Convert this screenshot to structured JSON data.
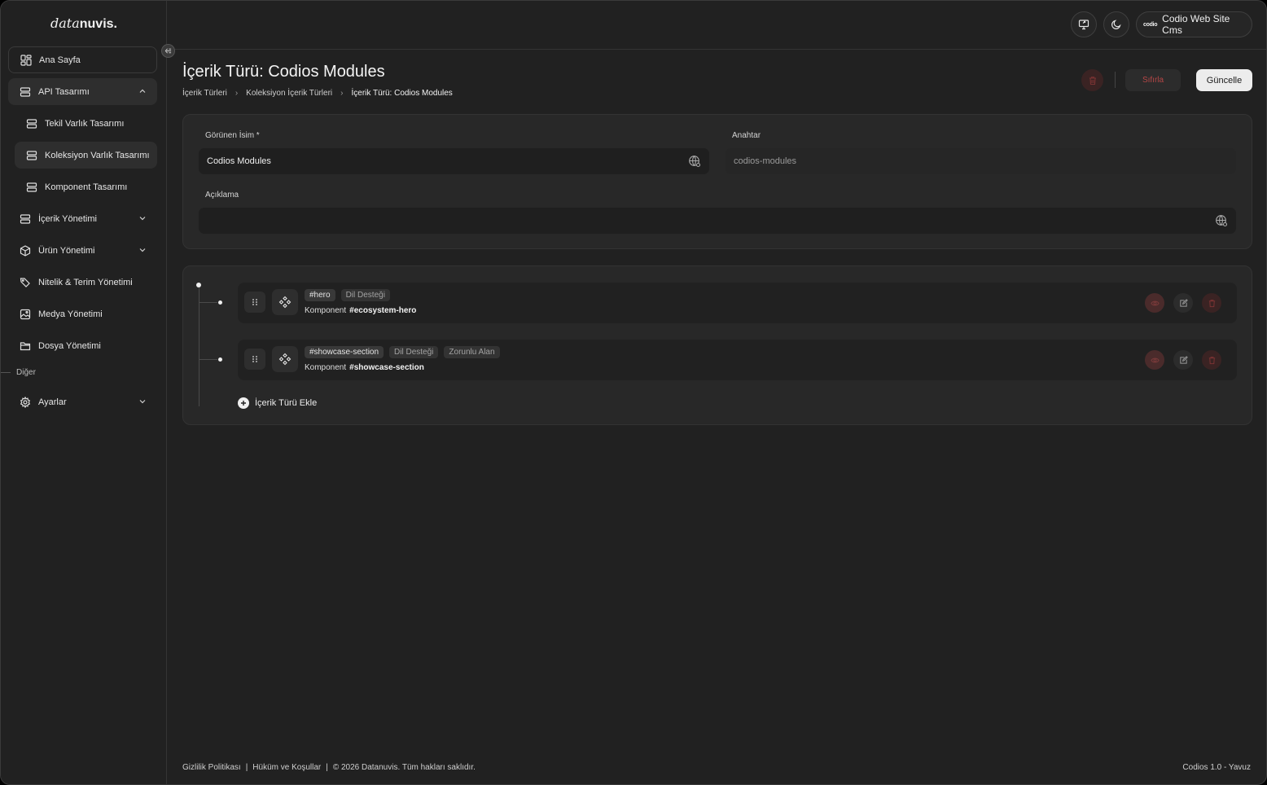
{
  "logo": {
    "light": "data",
    "bold": "nuvis."
  },
  "sidebar": {
    "items": [
      {
        "label": "Ana Sayfa"
      },
      {
        "label": "API Tasarımı"
      },
      {
        "label": "Tekil Varlık Tasarımı"
      },
      {
        "label": "Koleksiyon Varlık Tasarımı"
      },
      {
        "label": "Komponent Tasarımı"
      },
      {
        "label": "İçerik Yönetimi"
      },
      {
        "label": "Ürün Yönetimi"
      },
      {
        "label": "Nitelik & Terim Yönetimi"
      },
      {
        "label": "Medya Yönetimi"
      },
      {
        "label": "Dosya Yönetimi"
      }
    ],
    "section_other": "Diğer",
    "settings": "Ayarlar"
  },
  "topbar": {
    "brand_mark": "codio",
    "brand_label": "Codio Web Site Cms"
  },
  "page": {
    "title": "İçerik Türü: Codios Modules",
    "breadcrumb": [
      "İçerik Türleri",
      "Koleksiyon İçerik Türleri",
      "İçerik Türü: Codios Modules"
    ],
    "reset_label": "Sıfırla",
    "update_label": "Güncelle"
  },
  "form": {
    "display_name_label": "Görünen İsim *",
    "display_name_value": "Codios Modules",
    "key_label": "Anahtar",
    "key_value": "codios-modules",
    "description_label": "Açıklama",
    "description_value": ""
  },
  "modules": [
    {
      "tags": [
        "#hero",
        "Dil Desteği"
      ],
      "type_label": "Komponent",
      "ref": "#ecosystem-hero"
    },
    {
      "tags": [
        "#showcase-section",
        "Dil Desteği",
        "Zorunlu Alan"
      ],
      "type_label": "Komponent",
      "ref": "#showcase-section"
    }
  ],
  "add_content_type": "İçerik Türü Ekle",
  "footer": {
    "privacy": "Gizlilik Politikası",
    "terms": "Hüküm ve Koşullar",
    "copyright": "© 2026 Datanuvis. Tüm hakları saklıdır.",
    "version": "Codios 1.0 - Yavuz"
  },
  "colors": {
    "background": "#212121",
    "card": "#282828",
    "danger": "#b54646",
    "primary_button": "#ececec"
  }
}
